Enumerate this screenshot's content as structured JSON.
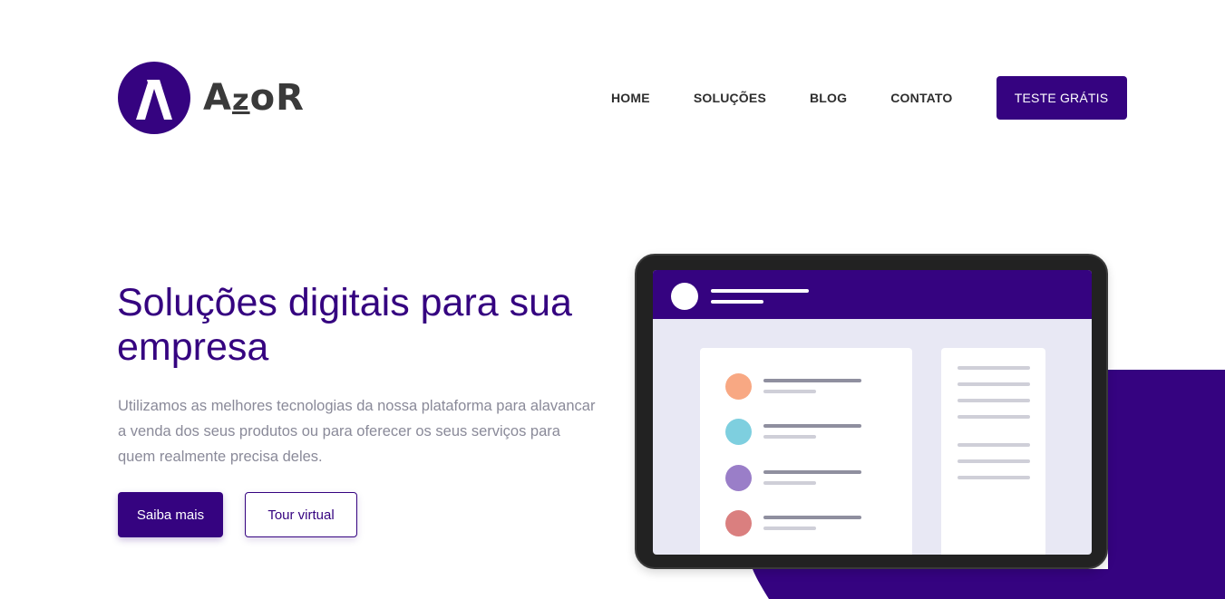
{
  "brand": {
    "name_part1": "A",
    "name_part2": "z",
    "name_part3": "oR",
    "logo_icon": "azor-logo-icon"
  },
  "nav": {
    "items": [
      {
        "label": "HOME"
      },
      {
        "label": "SOLUÇÕES"
      },
      {
        "label": "BLOG"
      },
      {
        "label": "CONTATO"
      }
    ],
    "cta_label": "TESTE GRÁTIS"
  },
  "hero": {
    "title": "Soluções digitais para sua empresa",
    "description": "Utilizamos as melhores tecnologias da nossa plataforma para alavancar a venda dos seus produtos ou para oferecer os seus serviços para quem realmente precisa deles.",
    "primary_button": "Saiba mais",
    "secondary_button": "Tour virtual"
  },
  "illustration": {
    "icon": "tablet-dashboard-illustration",
    "list_dot_colors": [
      "#f8a883",
      "#7ecfdf",
      "#9a7ec8",
      "#da7f7f"
    ]
  },
  "colors": {
    "brand_primary": "#350380",
    "text_muted": "#8a8a99"
  }
}
